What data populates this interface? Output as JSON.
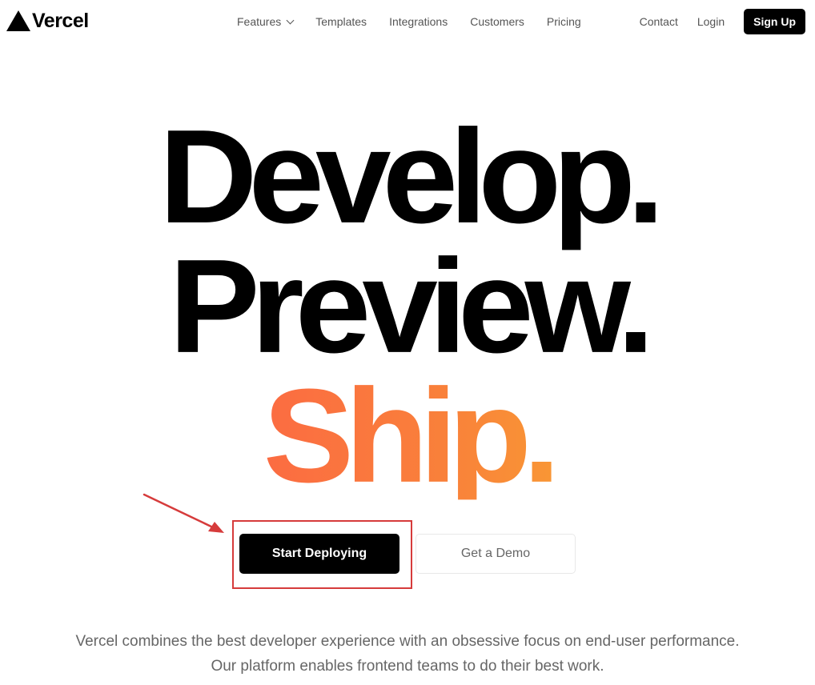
{
  "brand": {
    "name": "Vercel",
    "logo_icon": "triangle-logo-icon"
  },
  "nav": {
    "items": [
      {
        "label": "Features",
        "has_dropdown": true
      },
      {
        "label": "Templates"
      },
      {
        "label": "Integrations"
      },
      {
        "label": "Customers"
      },
      {
        "label": "Pricing"
      }
    ],
    "right": {
      "contact": "Contact",
      "login": "Login",
      "signup": "Sign Up"
    }
  },
  "hero": {
    "line1": "Develop.",
    "line2": "Preview.",
    "line3": "Ship.",
    "ship_gradient": [
      "#ff4d4d",
      "#f9cb28"
    ]
  },
  "cta": {
    "primary": "Start Deploying",
    "secondary": "Get a Demo"
  },
  "annotation": {
    "color": "#d63b3b"
  },
  "tagline": {
    "line1": "Vercel combines the best developer experience with an obsessive focus on end-user performance.",
    "line2": "Our platform enables frontend teams to do their best work."
  }
}
